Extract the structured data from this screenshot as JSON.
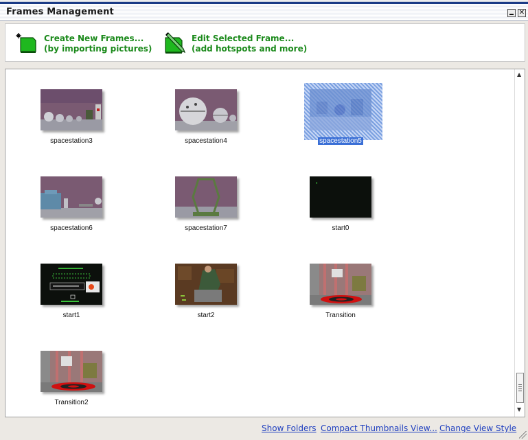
{
  "window": {
    "title": "Frames Management"
  },
  "toolbar": {
    "create_line1": "Create New Frames...",
    "create_line2": "(by importing pictures)",
    "edit_line1": "Edit Selected Frame...",
    "edit_line2": "(add hotspots and more)"
  },
  "frames": [
    {
      "name": "spacestation3",
      "selected": false
    },
    {
      "name": "spacestation4",
      "selected": false
    },
    {
      "name": "spacestation5",
      "selected": true
    },
    {
      "name": "spacestation6",
      "selected": false
    },
    {
      "name": "spacestation7",
      "selected": false
    },
    {
      "name": "start0",
      "selected": false
    },
    {
      "name": "start1",
      "selected": false
    },
    {
      "name": "start2",
      "selected": false
    },
    {
      "name": "Transition",
      "selected": false
    },
    {
      "name": "Transition2",
      "selected": false
    }
  ],
  "footer": {
    "show_folders": "Show Folders",
    "compact_view": "Compact Thumbnails View...",
    "change_style": "Change View Style"
  },
  "colors": {
    "accent_green": "#1c8a1c",
    "link_blue": "#1f3fbf",
    "selection_blue": "#3a6fd6"
  }
}
